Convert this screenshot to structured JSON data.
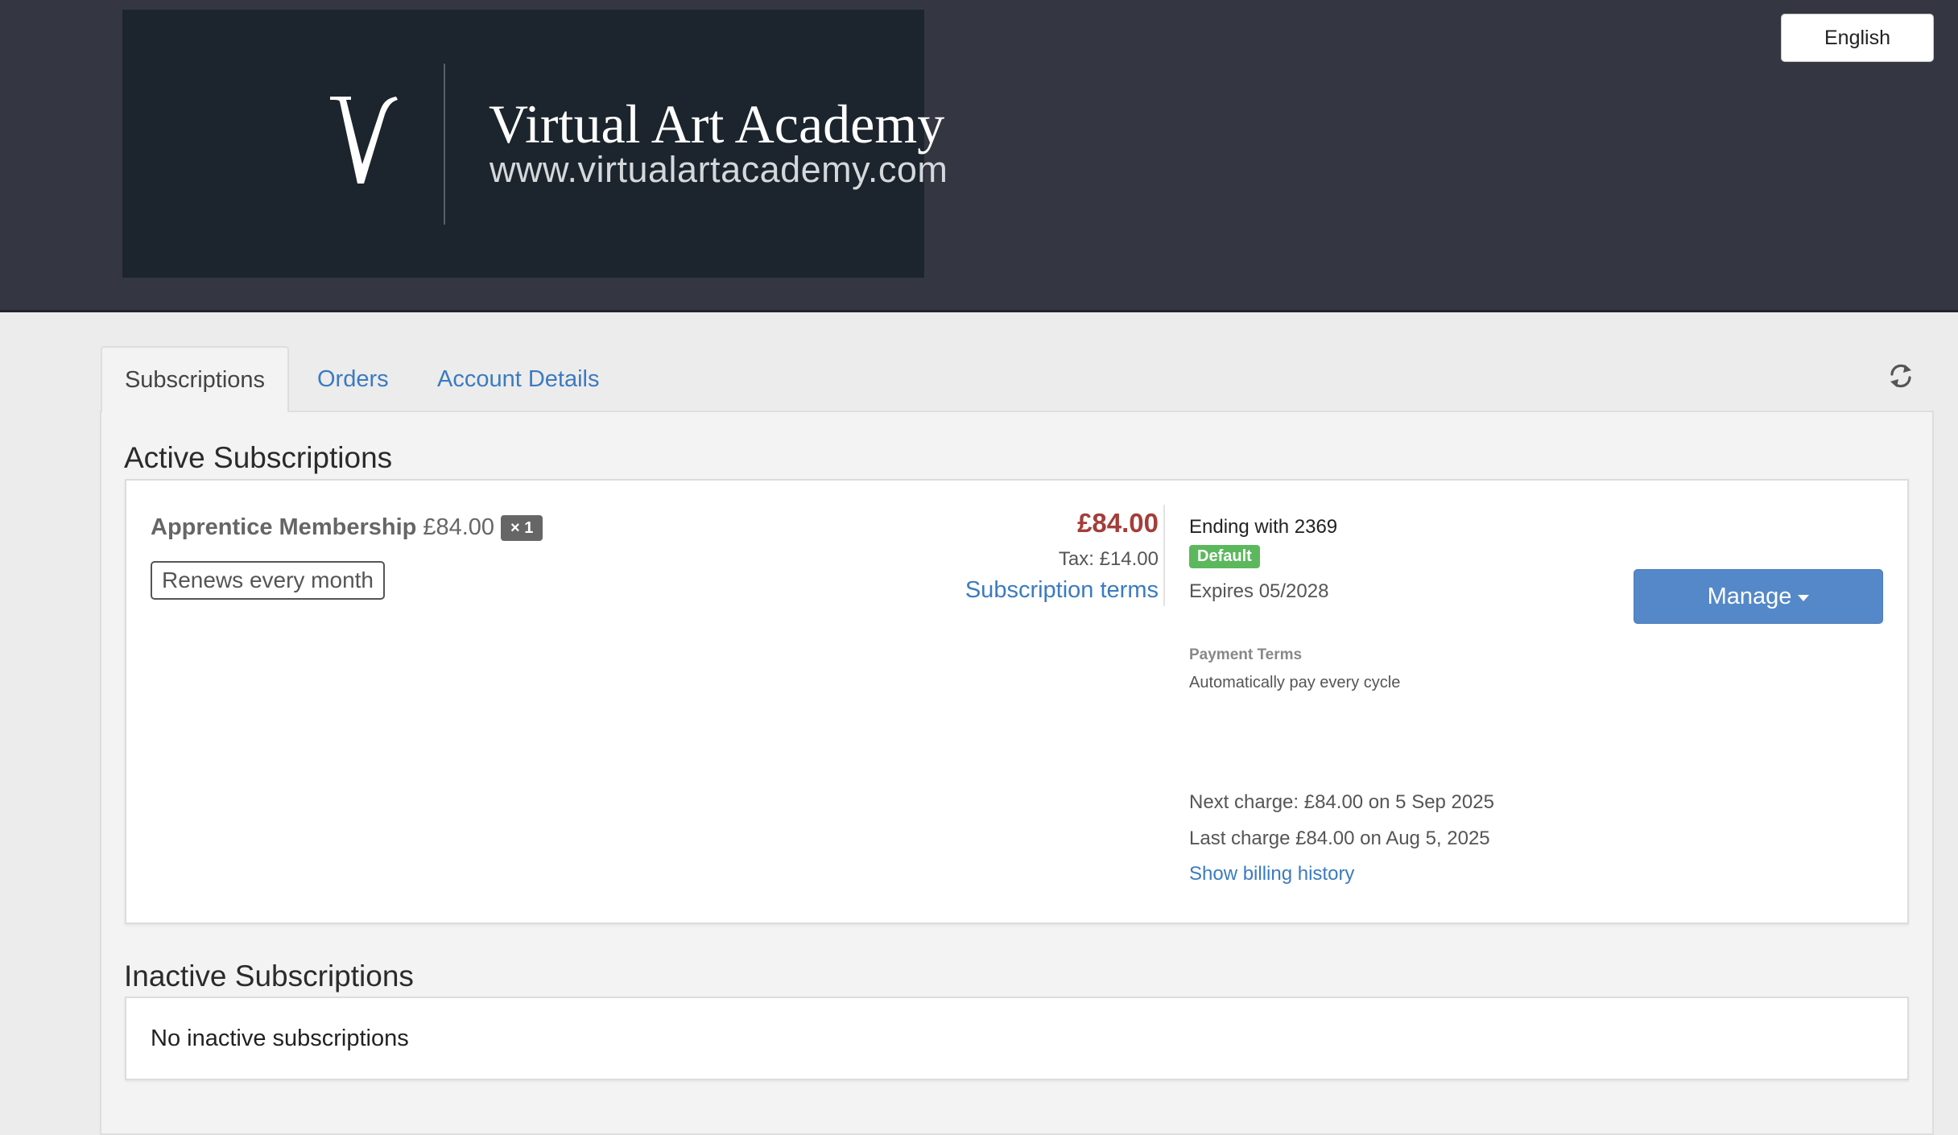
{
  "header": {
    "logo": {
      "monogram": "V",
      "name": "Virtual Art Academy",
      "url": "www.virtualartacademy.com"
    },
    "language_button": "English",
    "background_color": "#343741"
  },
  "tabs": [
    {
      "label": "Subscriptions",
      "active": true
    },
    {
      "label": "Orders",
      "active": false
    },
    {
      "label": "Account Details",
      "active": false
    }
  ],
  "refresh_icon": "refresh-icon",
  "active_subscriptions": {
    "title": "Active Subscriptions",
    "item": {
      "product_name": "Apprentice Membership",
      "unit_price": "£84.00",
      "quantity": "× 1",
      "renewal": "Renews every month",
      "total": "£84.00",
      "tax": "Tax: £14.00",
      "terms_link": "Subscription terms",
      "card_ending": "Ending with 2369",
      "default_badge": "Default",
      "expires": "Expires 05/2028",
      "payment_terms_label": "Payment Terms",
      "payment_terms_value": "Automatically pay every cycle",
      "next_charge": "Next charge: £84.00 on 5 Sep 2025",
      "last_charge": "Last charge £84.00 on Aug 5, 2025",
      "history_link": "Show billing history",
      "manage_button": "Manage"
    }
  },
  "inactive_subscriptions": {
    "title": "Inactive Subscriptions",
    "empty_text": "No inactive subscriptions"
  },
  "colors": {
    "link": "#3b7bc0",
    "price": "#a33e3a",
    "default_badge": "#5cb85c",
    "manage_button": "#5588c8"
  }
}
